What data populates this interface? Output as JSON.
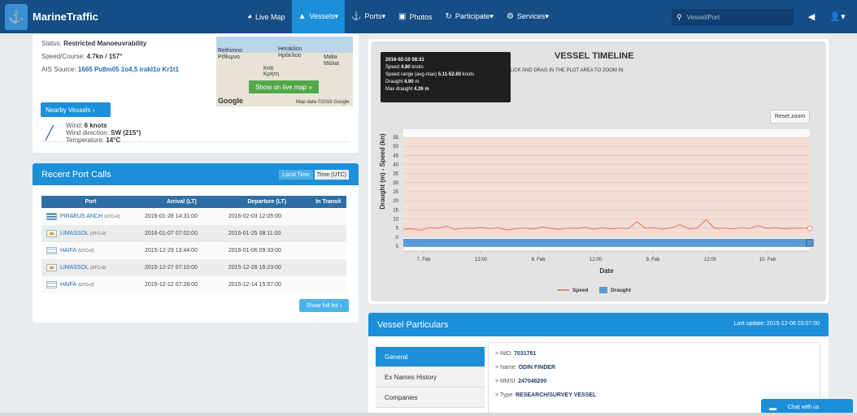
{
  "nav": {
    "brand": "MarineTraffic",
    "items": [
      {
        "icon": "globe-icon",
        "glyph": "◕",
        "label": "Live Map",
        "active": false
      },
      {
        "icon": "vessel-icon",
        "glyph": "▲",
        "label": "Vessels▾",
        "active": true
      },
      {
        "icon": "anchor-icon",
        "glyph": "⚓",
        "label": "Ports▾",
        "active": false
      },
      {
        "icon": "camera-icon",
        "glyph": "▣",
        "label": "Photos",
        "active": false
      },
      {
        "icon": "participate-icon",
        "glyph": "↻",
        "label": "Participate▾",
        "active": false
      },
      {
        "icon": "gear-icon",
        "glyph": "⚙",
        "label": "Services▾",
        "active": false
      }
    ],
    "search_placeholder": "Vessel/Port"
  },
  "vessel_info": {
    "status_label": "Status: ",
    "status_value": "Restricted Manoeuvrability",
    "speed_label": "Speed/Course: ",
    "speed_value": "4.7kn / 157°",
    "ais_label": "AIS Source: ",
    "ais_value": "1665 Pu8m05 1o4,5 irakl1o Kr1t1",
    "nearby_button": "Nearby Vessels ›",
    "map_button": "Show on live map »",
    "map_labels": [
      "Rethimno",
      "Ρέθυμνο",
      "Heraklion",
      "Ηράκλειο",
      "Malia",
      "Μάλια",
      "Kriti",
      "Κρήτη",
      "Google",
      "Map data ©2016 Google"
    ]
  },
  "weather": {
    "wind_label": "Wind: ",
    "wind_value": "6 knots",
    "direction_label": "Wind direction: ",
    "direction_value": "SW (215°)",
    "temp_label": "Temperature: ",
    "temp_value": "14°C"
  },
  "port_calls": {
    "title": "Recent Port Calls",
    "toggle_local": "Local Time",
    "toggle_utc": "Time (UTC)",
    "columns": [
      "Port",
      "Arrival (LT)",
      "Departure (LT)",
      "In Transit"
    ],
    "rows": [
      {
        "flag": "gr",
        "port": "PIRAEUS ANCH",
        "tz": "(UTC+2)",
        "arrival": "2016-01-28 14:31:00",
        "departure": "2016-02-03 12:05:00"
      },
      {
        "flag": "cy",
        "port": "LIMASSOL",
        "tz": "(UTC+2)",
        "arrival": "2016-01-07 07:02:00",
        "departure": "2016-01-25 08:11:00"
      },
      {
        "flag": "il",
        "port": "HAIFA",
        "tz": "(UTC+2)",
        "arrival": "2015-12-29 13:44:00",
        "departure": "2016-01-06 09:33:00"
      },
      {
        "flag": "cy",
        "port": "LIMASSOL",
        "tz": "(UTC+2)",
        "arrival": "2015-12-27 07:10:00",
        "departure": "2015-12-28 16:23:00"
      },
      {
        "flag": "il",
        "port": "HAIFA",
        "tz": "(UTC+2)",
        "arrival": "2015-12-12 07:28:00",
        "departure": "2015-12-14 15:57:00"
      }
    ],
    "show_full": "Show full list ›"
  },
  "timeline": {
    "title": "VESSEL TIMELINE",
    "subtitle": "CLICK AND DRAG IN THE PLOT AREA TO ZOOM IN",
    "reset": "Reset zoom",
    "tooltip": [
      {
        "label": "",
        "value": "2016-02-10 08:31",
        "bold": true
      },
      {
        "label": "Speed ",
        "value": "4.80",
        "suffix": " knots"
      },
      {
        "label": "Speed range (avg-max) ",
        "value": "5.11-52.60",
        "suffix": " knots"
      },
      {
        "label": "Draught ",
        "value": "4.90",
        "suffix": " m"
      },
      {
        "label": "Max draught ",
        "value": "4.26 m",
        "suffix": ""
      }
    ]
  },
  "chart_data": {
    "type": "line",
    "title": "VESSEL TIMELINE",
    "xlabel": "Date",
    "ylabel": "Draught (m) - Speed (kn)",
    "ylim": [
      -5,
      55
    ],
    "y_ticks": [
      55,
      50,
      45,
      40,
      35,
      30,
      25,
      20,
      15,
      10,
      5,
      0,
      5
    ],
    "x_ticks": [
      "7. Feb",
      "12:00",
      "8. Feb",
      "12:00",
      "9. Feb",
      "12:00",
      "10. Feb"
    ],
    "legend": [
      "Speed",
      "Draught"
    ],
    "legend_position": "bottom",
    "series": [
      {
        "name": "Speed",
        "color": "#e8866a",
        "values": [
          4.4,
          4.6,
          3.8,
          5.2,
          4.9,
          6.1,
          4.2,
          5.0,
          4.8,
          5.3,
          4.7,
          5.1,
          3.9,
          4.6,
          5.0,
          4.4,
          5.6,
          4.9,
          4.2,
          5.0,
          4.8,
          5.4,
          4.3,
          5.1,
          4.6,
          5.0,
          4.7,
          8.5,
          4.9,
          5.2,
          4.4,
          5.1,
          6.8,
          4.6,
          5.0,
          9.6,
          4.8,
          5.0,
          4.5,
          5.2,
          4.7,
          6.4,
          4.9,
          5.1,
          4.6,
          4.9,
          5.0,
          4.8
        ]
      },
      {
        "name": "Draught",
        "color": "#5b9bd5",
        "values": [
          -3.6,
          -3.6
        ]
      }
    ]
  },
  "particulars": {
    "title": "Vessel Particulars",
    "last_update": "Last update: 2015-12-08 03:07:00",
    "tabs": [
      "General",
      "Ex Names History",
      "Companies"
    ],
    "lines": [
      {
        "label": "> IMO: ",
        "value": "7031761"
      },
      {
        "label": "> Name: ",
        "value": "ODIN FINDER"
      },
      {
        "label": "> MMSI: ",
        "value": "247048200"
      },
      {
        "label": "> Type: ",
        "value": "RESEARCH/SURVEY VESSEL"
      }
    ]
  },
  "chat": {
    "label": "Chat with us"
  }
}
